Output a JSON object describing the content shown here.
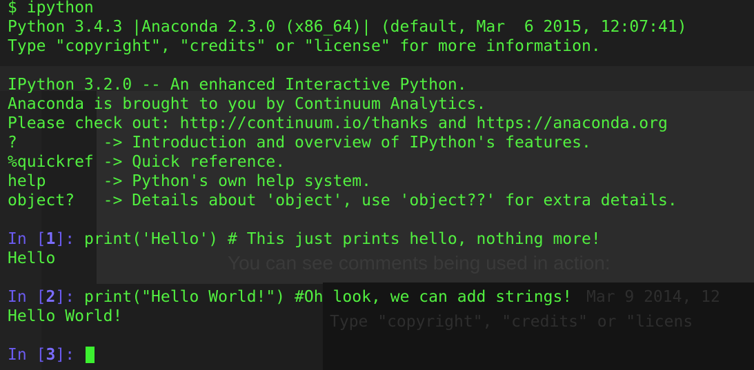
{
  "prompt_line": "$ ipython",
  "banner": [
    "Python 3.4.3 |Anaconda 2.3.0 (x86_64)| (default, Mar  6 2015, 12:07:41)",
    "Type \"copyright\", \"credits\" or \"license\" for more information."
  ],
  "ipython_info": [
    "IPython 3.2.0 -- An enhanced Interactive Python.",
    "Anaconda is brought to you by Continuum Analytics.",
    "Please check out: http://continuum.io/thanks and https://anaconda.org",
    "?         -> Introduction and overview of IPython's features.",
    "%quickref -> Quick reference.",
    "help      -> Python's own help system.",
    "object?   -> Details about 'object', use 'object??' for extra details."
  ],
  "cells": [
    {
      "label_prefix": "In [",
      "number": "1",
      "label_suffix": "]: ",
      "code": "print('Hello') # This just prints hello, nothing more!",
      "output": "Hello"
    },
    {
      "label_prefix": "In [",
      "number": "2",
      "label_suffix": "]: ",
      "code": "print(\"Hello World!\") #Oh look, we can add strings!",
      "output": "Hello World!"
    }
  ],
  "current_prompt": {
    "label_prefix": "In [",
    "number": "3",
    "label_suffix": "]: "
  },
  "background_text": {
    "caption": "You can see comments being used in action:",
    "line1": "Mar  9 2014, 12",
    "line2": "Type \"copyright\", \"credits\" or \"licens"
  },
  "colors": {
    "text_green": "#52f040",
    "prompt_purple": "#6b5bf0",
    "cursor_green": "#3cf030",
    "background": "#1e1e1e"
  }
}
